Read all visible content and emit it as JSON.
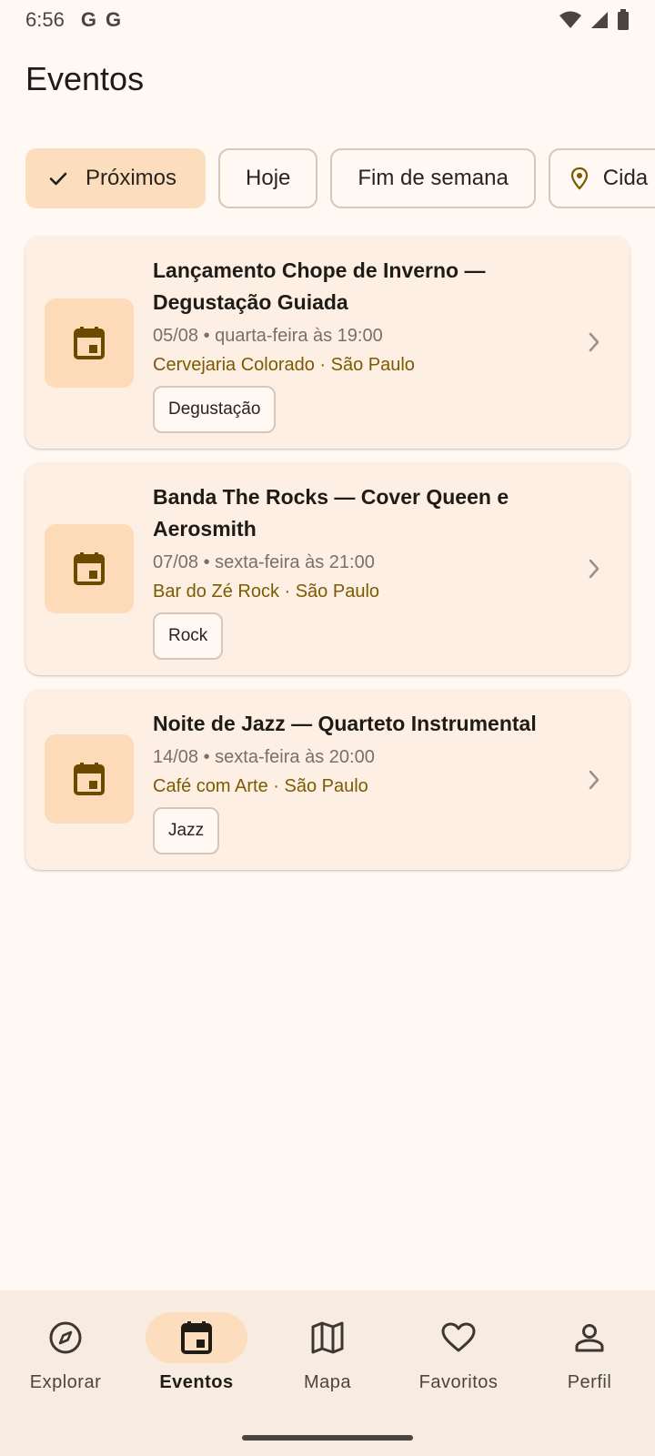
{
  "status": {
    "time": "6:56",
    "g1": "G",
    "g2": "G"
  },
  "title": "Eventos",
  "chips": [
    {
      "label": "Próximos",
      "selected": true,
      "icon": "check-icon"
    },
    {
      "label": "Hoje",
      "selected": false
    },
    {
      "label": "Fim de semana",
      "selected": false
    },
    {
      "label": "Cida",
      "selected": false,
      "icon": "location-pin-icon"
    }
  ],
  "events": [
    {
      "title": "Lançamento Chope de Inverno — Degustação Guiada",
      "date": "05/08 • quarta-feira às 19:00",
      "venue": "Cervejaria Colorado · São Paulo",
      "tag": "Degustação"
    },
    {
      "title": "Banda The Rocks — Cover Queen e Aerosmith",
      "date": "07/08 • sexta-feira às 21:00",
      "venue": "Bar do Zé Rock · São Paulo",
      "tag": "Rock"
    },
    {
      "title": "Noite de Jazz — Quarteto Instrumental",
      "date": "14/08 • sexta-feira às 20:00",
      "venue": "Café com Arte · São Paulo",
      "tag": "Jazz"
    }
  ],
  "nav": [
    {
      "label": "Explorar",
      "icon": "compass-icon",
      "active": false
    },
    {
      "label": "Eventos",
      "icon": "calendar-icon",
      "active": true
    },
    {
      "label": "Mapa",
      "icon": "map-icon",
      "active": false
    },
    {
      "label": "Favoritos",
      "icon": "heart-icon",
      "active": false
    },
    {
      "label": "Perfil",
      "icon": "person-icon",
      "active": false
    }
  ],
  "colors": {
    "background": "#FFF8F3",
    "accent": "#FCDDBE",
    "venue_text": "#7C5A00",
    "icon_brown": "#6B4A00"
  }
}
